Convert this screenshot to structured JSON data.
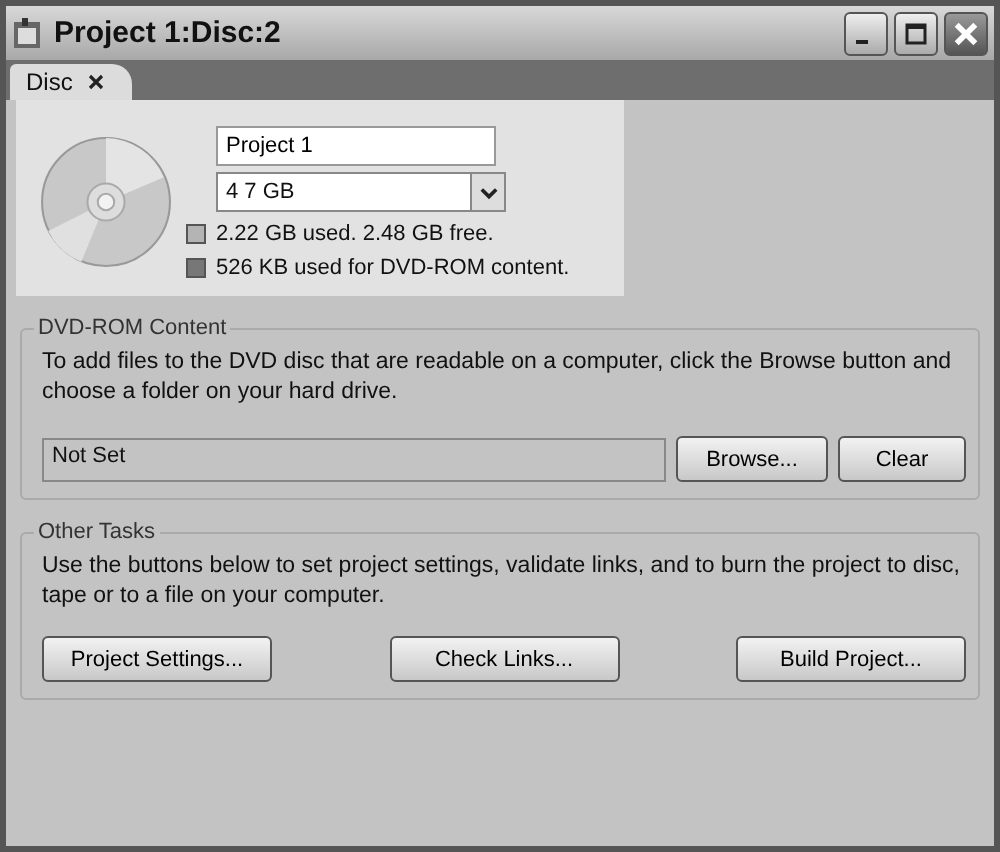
{
  "window": {
    "title": "Project 1:Disc:2"
  },
  "tabs": [
    {
      "label": "Disc",
      "selected": true
    }
  ],
  "disc": {
    "name": "Project 1",
    "size": "4 7 GB",
    "legend": [
      {
        "text": "2.22 GB used.  2.48 GB free.",
        "color": "#b4b4b4"
      },
      {
        "text": "526 KB used for DVD-ROM content.",
        "color": "#777777"
      }
    ]
  },
  "dvd_rom": {
    "title": "DVD-ROM Content",
    "description": "To add files to the DVD disc that are readable on a computer, click the Browse button and choose a folder on your hard drive.",
    "folder": "Not Set",
    "buttons": [
      "Browse...",
      "Clear"
    ]
  },
  "other_tasks": {
    "title": "Other Tasks",
    "description": "Use the buttons below to set project settings, validate links, and to burn the project to disc, tape or to a file on your computer.",
    "buttons": [
      "Project Settings...",
      "Check Links...",
      "Build Project..."
    ]
  }
}
